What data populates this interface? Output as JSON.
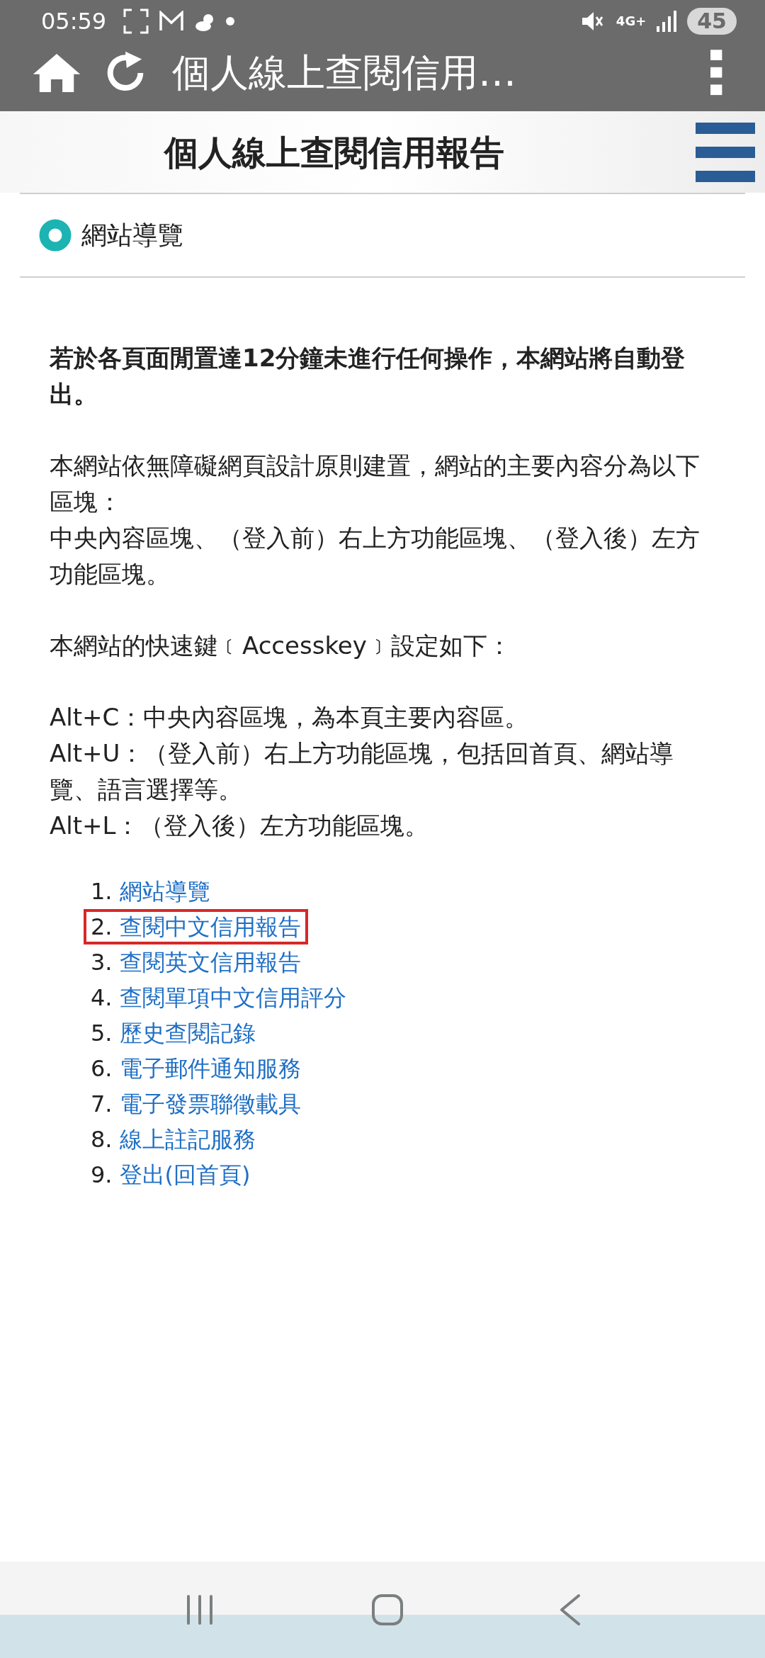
{
  "status_bar": {
    "time": "05:59",
    "network": "4G+",
    "battery": "45"
  },
  "app_bar": {
    "title": "個人線上查閱信用…"
  },
  "header": {
    "title": "個人線上查閱信用報告"
  },
  "breadcrumb": {
    "label": "網站導覽"
  },
  "blocks": [
    {
      "kind": "bold",
      "lines": [
        "若於各頁面閒置達12分鐘未進行任何操作，本網站將自動登出。"
      ]
    },
    {
      "kind": "normal",
      "lines": [
        "本網站依無障礙網頁設計原則建置，網站的主要內容分為以下區塊：",
        "中央內容區塊、（登入前）右上方功能區塊、（登入後）左方功能區塊。"
      ]
    },
    {
      "kind": "normal",
      "lines": [
        "本網站的快速鍵﹝Accesskey﹞設定如下："
      ]
    },
    {
      "kind": "normal",
      "lines": [
        "Alt+C：中央內容區塊，為本頁主要內容區。",
        "Alt+U：（登入前）右上方功能區塊，包括回首頁、網站導覽、語言選擇等。",
        "Alt+L：（登入後）左方功能區塊。"
      ]
    }
  ],
  "links": [
    {
      "number": "1.",
      "label": "網站導覽",
      "highlighted": false
    },
    {
      "number": "2.",
      "label": "查閱中文信用報告",
      "highlighted": true
    },
    {
      "number": "3.",
      "label": "查閱英文信用報告",
      "highlighted": false
    },
    {
      "number": "4.",
      "label": "查閱單項中文信用評分",
      "highlighted": false
    },
    {
      "number": "5.",
      "label": "歷史查閱記錄",
      "highlighted": false
    },
    {
      "number": "6.",
      "label": "電子郵件通知服務",
      "highlighted": false
    },
    {
      "number": "7.",
      "label": "電子發票聯徵載具",
      "highlighted": false
    },
    {
      "number": "8.",
      "label": "線上註記服務",
      "highlighted": false
    },
    {
      "number": "9.",
      "label": "登出(回首頁)",
      "highlighted": false
    }
  ]
}
